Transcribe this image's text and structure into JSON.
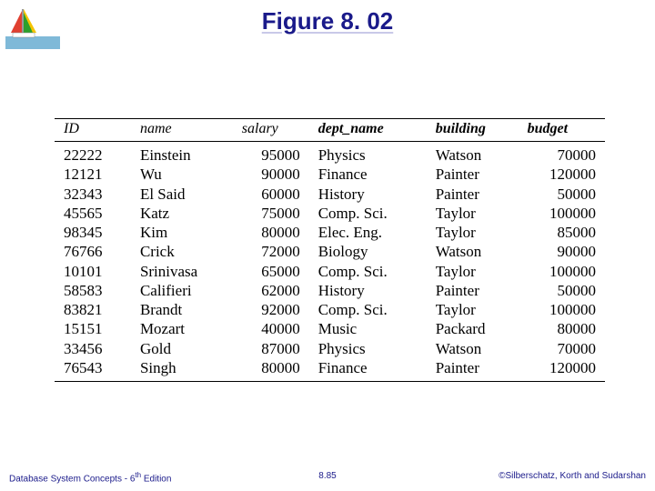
{
  "title": "Figure 8. 02",
  "chart_data": {
    "type": "table",
    "columns": [
      "ID",
      "name",
      "salary",
      "dept_name",
      "building",
      "budget"
    ],
    "rows": [
      [
        "22222",
        "Einstein",
        "95000",
        "Physics",
        "Watson",
        "70000"
      ],
      [
        "12121",
        "Wu",
        "90000",
        "Finance",
        "Painter",
        "120000"
      ],
      [
        "32343",
        "El Said",
        "60000",
        "History",
        "Painter",
        "50000"
      ],
      [
        "45565",
        "Katz",
        "75000",
        "Comp. Sci.",
        "Taylor",
        "100000"
      ],
      [
        "98345",
        "Kim",
        "80000",
        "Elec. Eng.",
        "Taylor",
        "85000"
      ],
      [
        "76766",
        "Crick",
        "72000",
        "Biology",
        "Watson",
        "90000"
      ],
      [
        "10101",
        "Srinivasa",
        "65000",
        "Comp. Sci.",
        "Taylor",
        "100000"
      ],
      [
        "58583",
        "Califieri",
        "62000",
        "History",
        "Painter",
        "50000"
      ],
      [
        "83821",
        "Brandt",
        "92000",
        "Comp. Sci.",
        "Taylor",
        "100000"
      ],
      [
        "15151",
        "Mozart",
        "40000",
        "Music",
        "Packard",
        "80000"
      ],
      [
        "33456",
        "Gold",
        "87000",
        "Physics",
        "Watson",
        "70000"
      ],
      [
        "76543",
        "Singh",
        "80000",
        "Finance",
        "Painter",
        "120000"
      ]
    ]
  },
  "footer": {
    "left_prefix": "Database System Concepts - 6",
    "left_sup": "th",
    "left_suffix": " Edition",
    "center": "8.85",
    "right": "©Silberschatz, Korth and Sudarshan"
  }
}
